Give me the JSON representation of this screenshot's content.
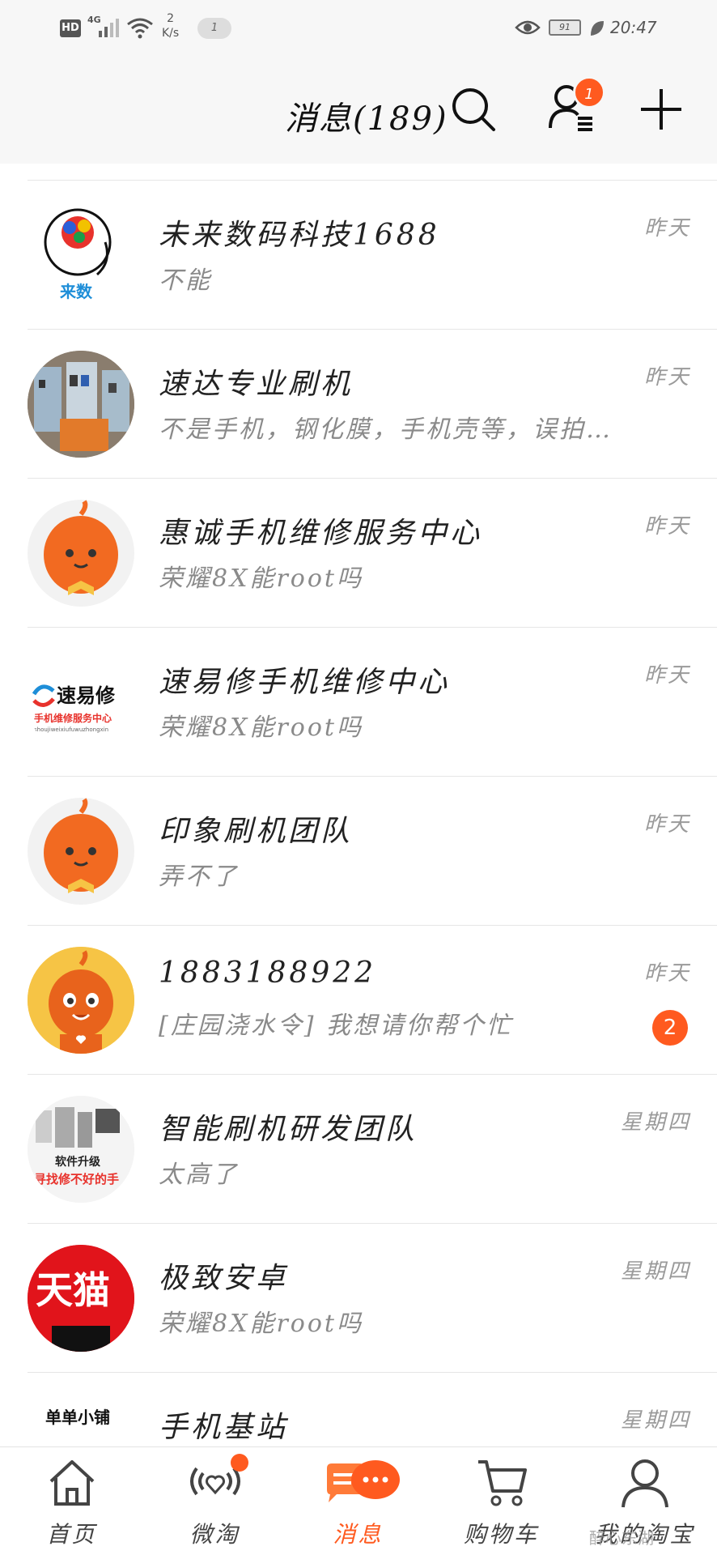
{
  "status_bar": {
    "hd": "HD",
    "network": "4G",
    "speed_value": "2",
    "speed_unit": "K/s",
    "notification_pill": "1",
    "battery": "91",
    "time": "20:47"
  },
  "header": {
    "title": "消息(189)",
    "contacts_badge": "1"
  },
  "conversations": [
    {
      "name": "未来数码科技1688",
      "message": "不能",
      "time": "昨天",
      "avatar": "weilai-shuma-logo"
    },
    {
      "name": "速达专业刷机",
      "message": "不是手机，钢化膜，手机壳等，误拍…",
      "time": "昨天",
      "avatar": "shop-photo"
    },
    {
      "name": "惠诚手机维修服务中心",
      "message": "荣耀8X能root吗",
      "time": "昨天",
      "avatar": "taobao-mascot"
    },
    {
      "name": "速易修手机维修中心",
      "message": "荣耀8X能root吗",
      "time": "昨天",
      "avatar": "suyixiu-logo"
    },
    {
      "name": "印象刷机团队",
      "message": "弄不了",
      "time": "昨天",
      "avatar": "taobao-mascot"
    },
    {
      "name": "1883188922",
      "message": "[庄园浇水令] 我想请你帮个忙",
      "time": "昨天",
      "badge": "2",
      "avatar": "taobao-mascot-yellow"
    },
    {
      "name": "智能刷机研发团队",
      "message": "太高了",
      "time": "星期四",
      "avatar": "shuaji-text-logo"
    },
    {
      "name": "极致安卓",
      "message": "荣耀8X能root吗",
      "time": "星期四",
      "avatar": "tmall-logo"
    },
    {
      "name": "手机基站",
      "message": "",
      "time": "星期四",
      "avatar": "dandan-shop-logo"
    }
  ],
  "avatar_texts": {
    "weilai": "来数",
    "suyixiu_brand": "速易修",
    "suyixiu_sub": "手机维修服务中心",
    "suyixiu_pinyin": "shoujiweixiufuwuzhongxin",
    "shuaji_top": "软件升级",
    "shuaji_bottom": "寻找修不好的手",
    "tmall": "天猫",
    "dandan": "单单小铺"
  },
  "tabs": [
    {
      "label": "首页",
      "icon": "home-icon"
    },
    {
      "label": "微淘",
      "icon": "weitao-icon"
    },
    {
      "label": "消息",
      "icon": "message-icon"
    },
    {
      "label": "购物车",
      "icon": "cart-icon"
    },
    {
      "label": "我的淘宝",
      "icon": "profile-icon"
    }
  ],
  "watermark": "醉心东湖",
  "colors": {
    "accent": "#ff5a1f",
    "background": "#ffffff",
    "header_bg": "#f7f7f7",
    "secondary_text": "#8a8a8a"
  }
}
